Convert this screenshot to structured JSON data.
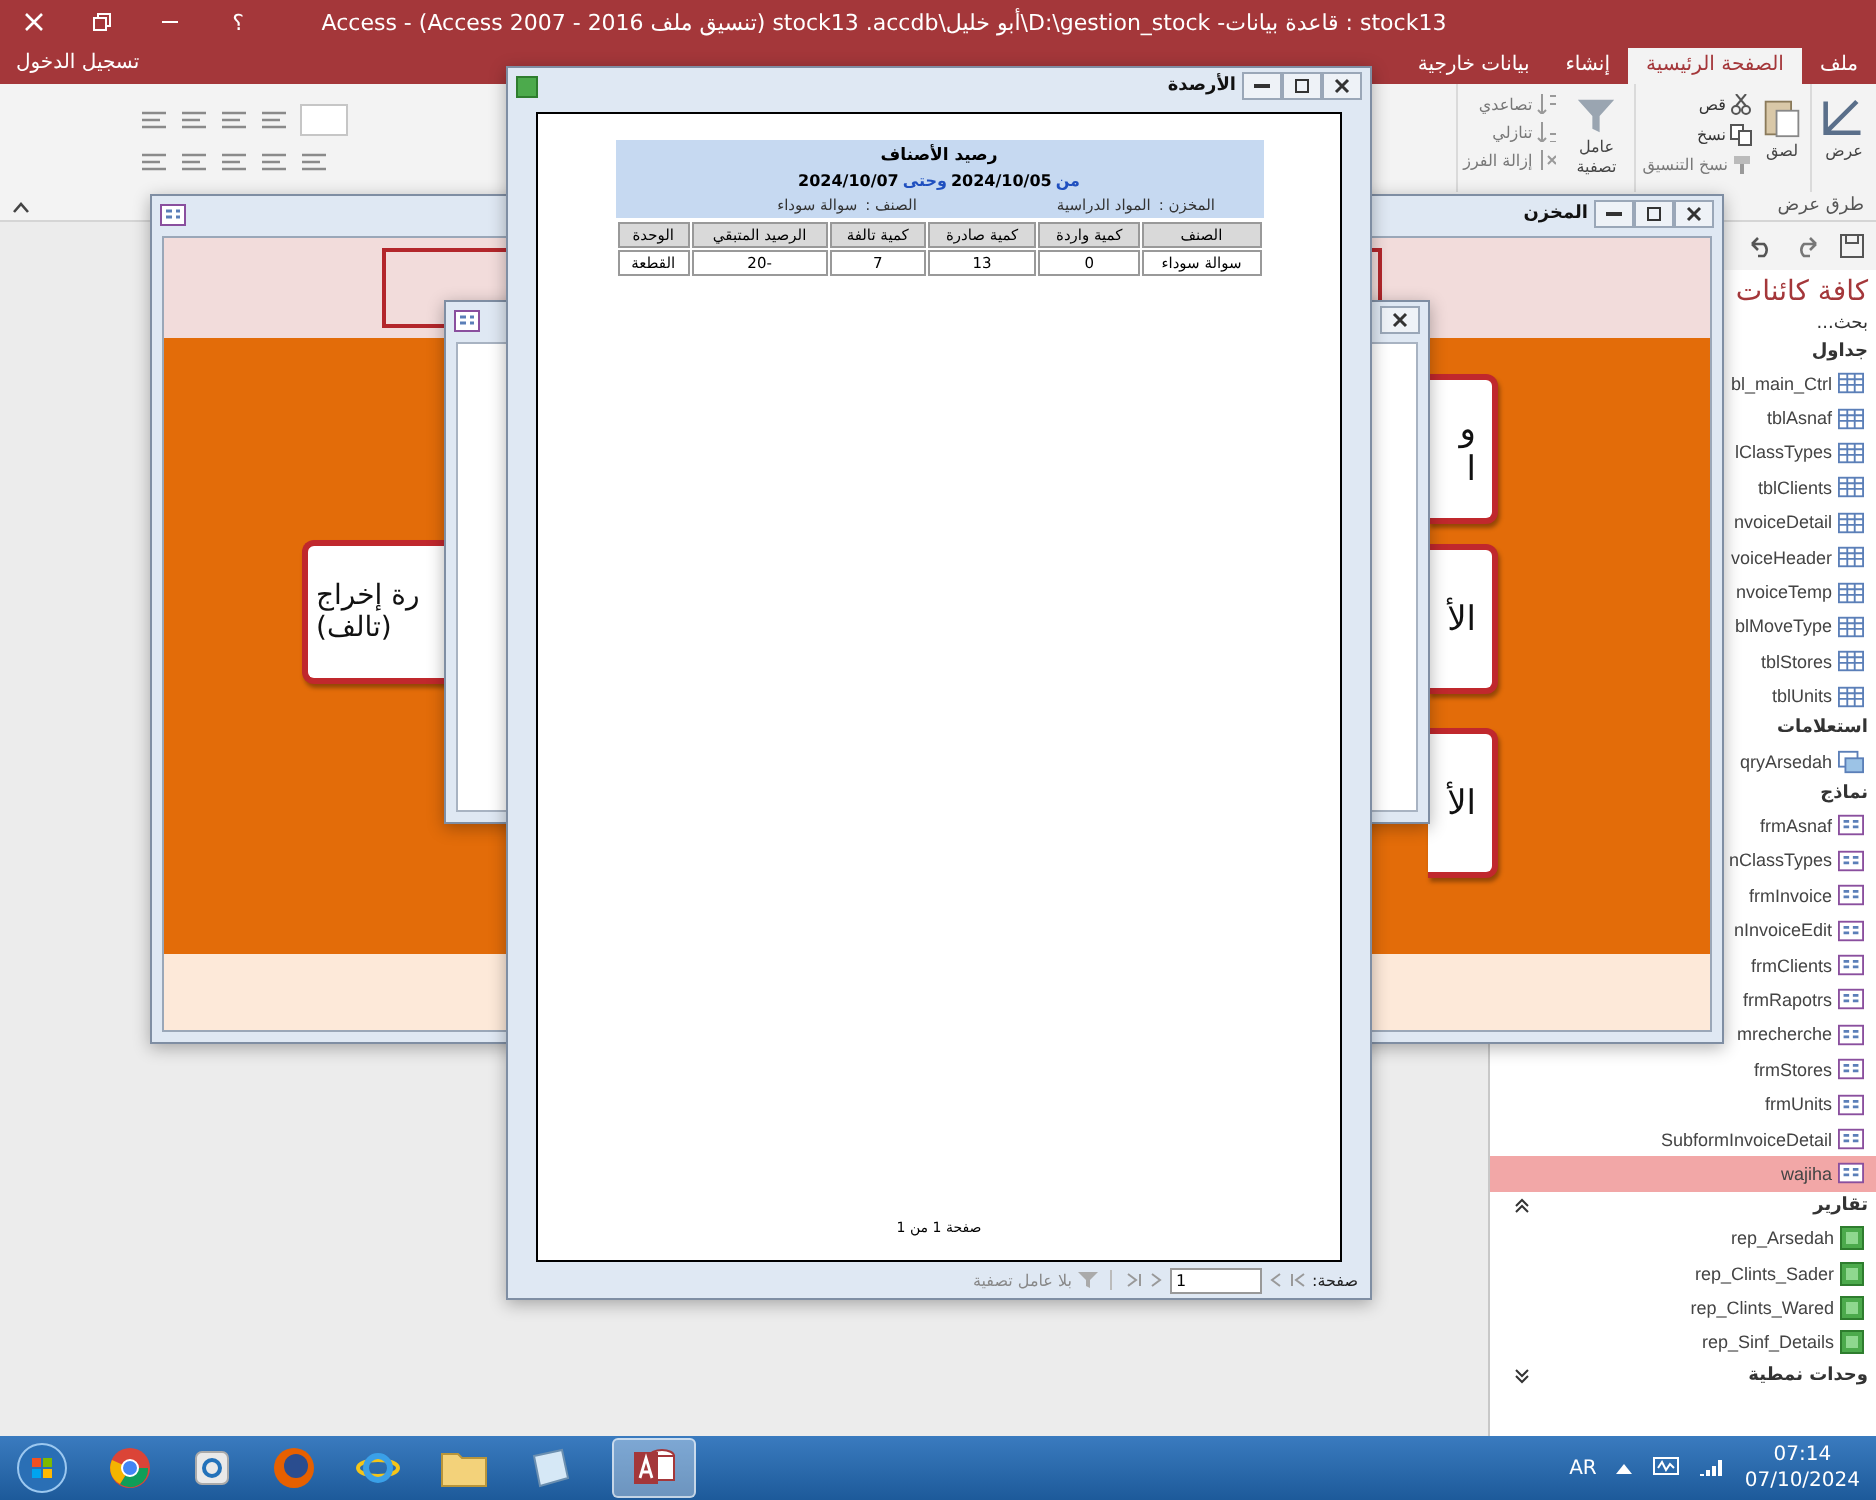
{
  "title_bar": {
    "title": "stock13 : قاعدة بيانات- D:\\gestion_stock\\أبو خليل\\stock13 .accdb (تنسيق ملف Access 2007 - 2016) - Access",
    "help": "؟"
  },
  "sign_in": "تسجيل الدخول",
  "tabs": [
    {
      "label": "ملف",
      "selected": false
    },
    {
      "label": "الصفحة الرئيسية",
      "selected": true
    },
    {
      "label": "إنشاء",
      "selected": false
    },
    {
      "label": "بيانات خارجية",
      "selected": false
    }
  ],
  "ribbon": {
    "view": "عرض",
    "paste": "لصق",
    "cut": "قص",
    "copy": "نسخ",
    "format_painter": "نسخ التنسيق",
    "filter": "عامل تصفية",
    "ascending": "تصاعدي",
    "descending": "تنازلي",
    "remove_sort": "إزالة الفرز",
    "group_label": "طرق عرض"
  },
  "nav_pane": {
    "header": "كافة كائنات",
    "search": {
      "placeholder": "بحث..."
    },
    "groups": [
      {
        "kind": "tables",
        "label": "جداول",
        "items": [
          {
            "name": "bl_main_Ctrl",
            "selected": false
          },
          {
            "name": "tblAsnaf",
            "selected": false
          },
          {
            "name": "lClassTypes",
            "selected": false
          },
          {
            "name": "tblClients",
            "selected": false
          },
          {
            "name": "nvoiceDetail",
            "selected": false
          },
          {
            "name": "voiceHeader",
            "selected": false
          },
          {
            "name": "nvoiceTemp",
            "selected": false
          },
          {
            "name": "blMoveType",
            "selected": false
          },
          {
            "name": "tblStores",
            "selected": false
          },
          {
            "name": "tblUnits",
            "selected": false
          }
        ]
      },
      {
        "kind": "queries",
        "label": "استعلامات",
        "items": [
          {
            "name": "qryArsedah",
            "selected": false
          }
        ]
      },
      {
        "kind": "forms",
        "label": "نماذج",
        "items": [
          {
            "name": "frmAsnaf",
            "selected": false
          },
          {
            "name": "nClassTypes",
            "selected": false
          },
          {
            "name": "frmInvoice",
            "selected": false
          },
          {
            "name": "nInvoiceEdit",
            "selected": false
          },
          {
            "name": "frmClients",
            "selected": false
          },
          {
            "name": "frmRapotrs",
            "selected": false
          },
          {
            "name": "mrecherche",
            "selected": false
          },
          {
            "name": "frmStores",
            "selected": false
          },
          {
            "name": "frmUnits",
            "selected": false
          },
          {
            "name": "SubformInvoiceDetail",
            "selected": false
          },
          {
            "name": "wajiha",
            "selected": true
          }
        ]
      },
      {
        "kind": "reports",
        "label": "تقارير",
        "expanded": true,
        "items": [
          {
            "name": "rep_Arsedah",
            "selected": false
          },
          {
            "name": "rep_Clints_Sader",
            "selected": false
          },
          {
            "name": "rep_Clints_Wared",
            "selected": false
          },
          {
            "name": "rep_Sinf_Details",
            "selected": false
          }
        ]
      },
      {
        "label": "وحدات نمطية",
        "expanded": false
      }
    ]
  },
  "store_window": {
    "title": "المخزن",
    "left_button": {
      "lines": [
        "رة إخراج",
        "(تالف)"
      ]
    },
    "right_buttons": [
      {
        "lines": [
          "و",
          "ا"
        ]
      },
      {
        "lines": [
          "الأ"
        ]
      },
      {
        "lines": [
          "الأ"
        ]
      }
    ]
  },
  "report_window": {
    "title": "الأرصدة",
    "report": {
      "title": "رصيد الأصناف",
      "from_label": "من",
      "from_date": "2024/10/05",
      "to_label": "وحتى",
      "to_date": "2024/10/07",
      "store_label": "المخزن :",
      "store": "المواد الدراسية",
      "item_label": "الصنف :",
      "item": "سوالة سوداء",
      "columns": [
        "الصنف",
        "كمية واردة",
        "كمية صادرة",
        "كمية تالفة",
        "الرصيد المتبقي",
        "الوحدة"
      ],
      "rows": [
        [
          "سوالة سوداء",
          "0",
          "13",
          "7",
          "-20",
          "القطعة"
        ]
      ],
      "footer": "صفحة 1 من 1"
    },
    "status": {
      "page_label": "صفحة:",
      "page": "1",
      "filter": "بلا عامل تصفية"
    }
  },
  "taskbar": {
    "language": "AR",
    "time": "07:14",
    "date": "07/10/2024"
  }
}
